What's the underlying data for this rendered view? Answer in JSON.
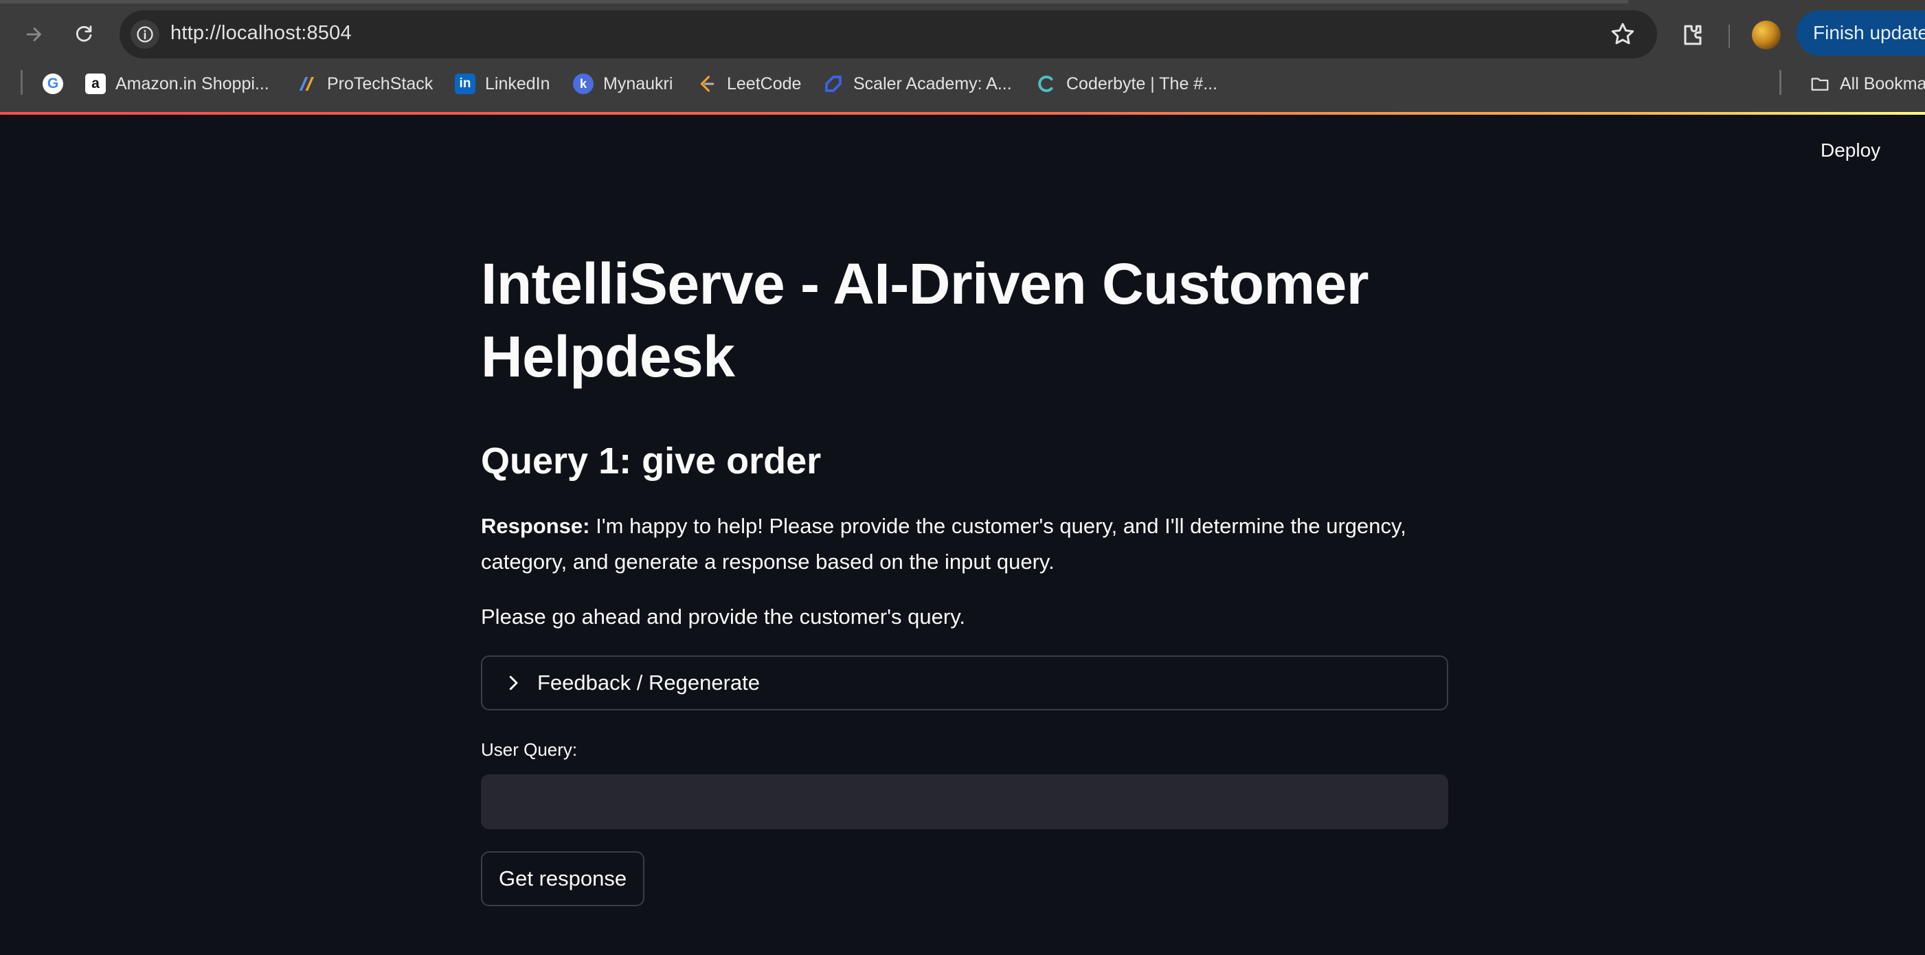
{
  "browser": {
    "url": "http://localhost:8504",
    "finish_update_label": "Finish update",
    "bookmarks": [
      {
        "label": "",
        "icon": "google-icon"
      },
      {
        "label": "Amazon.in Shoppi...",
        "icon": "amazon-icon"
      },
      {
        "label": "ProTechStack",
        "icon": "protechstack-icon"
      },
      {
        "label": "LinkedIn",
        "icon": "linkedin-icon"
      },
      {
        "label": "Mynaukri",
        "icon": "mynaukri-icon"
      },
      {
        "label": "LeetCode",
        "icon": "leetcode-icon"
      },
      {
        "label": "Scaler Academy: A...",
        "icon": "scaler-icon"
      },
      {
        "label": "Coderbyte | The #...",
        "icon": "coderbyte-icon"
      }
    ],
    "all_bookmarks_label": "All Bookmarks"
  },
  "app": {
    "deploy_label": "Deploy",
    "title": "IntelliServe - AI-Driven Customer Helpdesk",
    "query_heading": "Query 1: give order",
    "response_label": "Response:",
    "response_text": " I'm happy to help! Please provide the customer's query, and I'll determine the urgency, category, and generate a response based on the input query.",
    "response_followup": "Please go ahead and provide the customer's query.",
    "expander_label": "Feedback / Regenerate",
    "user_query_label": "User Query:",
    "user_query_value": "",
    "get_response_label": "Get response"
  },
  "colors": {
    "background": "#0e1117",
    "input_bg": "#262730",
    "accent": "#ff4b4b"
  }
}
